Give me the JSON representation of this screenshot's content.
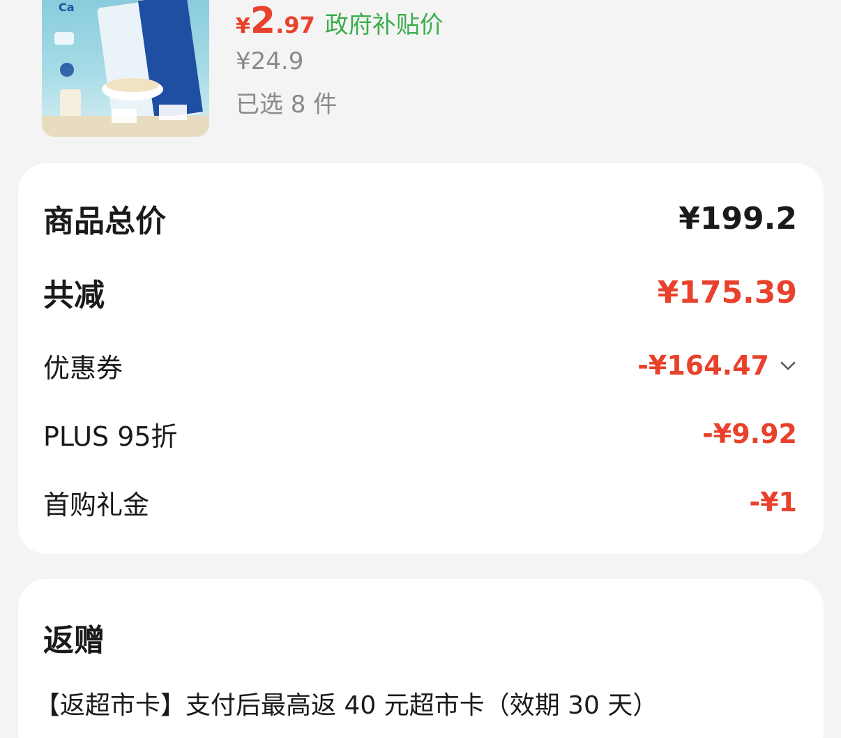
{
  "product": {
    "image_alt": "高钙奶香原味营养燕麦片",
    "price": {
      "symbol": "¥",
      "integer": "2",
      "decimal": ".97",
      "label": "政府补贴价"
    },
    "original_price": "¥24.9",
    "selected_count": "已选 8 件"
  },
  "summary": {
    "total_label": "商品总价",
    "total_value": "¥199.2",
    "reduction_label": "共减",
    "reduction_value": "¥175.39",
    "items": [
      {
        "label": "优惠券",
        "value": "-¥164.47",
        "expandable": true
      },
      {
        "label": "PLUS 95折",
        "value": "-¥9.92"
      },
      {
        "label": "首购礼金",
        "value": "-¥1"
      }
    ]
  },
  "rebate": {
    "title": "返赠",
    "description": "【返超市卡】支付后最高返 40 元超市卡（效期 30 天）"
  },
  "colors": {
    "accent_red": "#e8412c",
    "subsidy_green": "#3cad4e",
    "muted_gray": "#8a8a8a",
    "background": "#f4f4f4"
  }
}
